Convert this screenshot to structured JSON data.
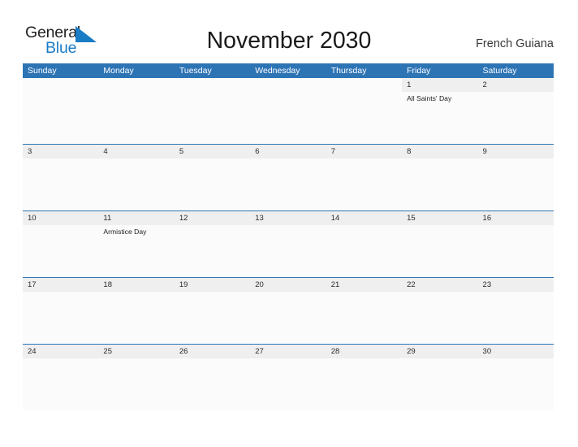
{
  "brand": {
    "name_part1": "General",
    "name_part2": "Blue",
    "flag_icon": "flag-triangle-icon",
    "color_dark": "#231f20",
    "color_blue": "#1a7cc4"
  },
  "header": {
    "title": "November 2030",
    "region": "French Guiana"
  },
  "calendar": {
    "header_background": "#2d74b5",
    "date_strip_background": "#efefef",
    "rule_color": "#2d74b5",
    "weekdays": [
      "Sunday",
      "Monday",
      "Tuesday",
      "Wednesday",
      "Thursday",
      "Friday",
      "Saturday"
    ],
    "weeks": [
      {
        "days": [
          {
            "date": "",
            "event": ""
          },
          {
            "date": "",
            "event": ""
          },
          {
            "date": "",
            "event": ""
          },
          {
            "date": "",
            "event": ""
          },
          {
            "date": "",
            "event": ""
          },
          {
            "date": "1",
            "event": "All Saints' Day"
          },
          {
            "date": "2",
            "event": ""
          }
        ]
      },
      {
        "days": [
          {
            "date": "3",
            "event": ""
          },
          {
            "date": "4",
            "event": ""
          },
          {
            "date": "5",
            "event": ""
          },
          {
            "date": "6",
            "event": ""
          },
          {
            "date": "7",
            "event": ""
          },
          {
            "date": "8",
            "event": ""
          },
          {
            "date": "9",
            "event": ""
          }
        ]
      },
      {
        "days": [
          {
            "date": "10",
            "event": ""
          },
          {
            "date": "11",
            "event": "Armistice Day"
          },
          {
            "date": "12",
            "event": ""
          },
          {
            "date": "13",
            "event": ""
          },
          {
            "date": "14",
            "event": ""
          },
          {
            "date": "15",
            "event": ""
          },
          {
            "date": "16",
            "event": ""
          }
        ]
      },
      {
        "days": [
          {
            "date": "17",
            "event": ""
          },
          {
            "date": "18",
            "event": ""
          },
          {
            "date": "19",
            "event": ""
          },
          {
            "date": "20",
            "event": ""
          },
          {
            "date": "21",
            "event": ""
          },
          {
            "date": "22",
            "event": ""
          },
          {
            "date": "23",
            "event": ""
          }
        ]
      },
      {
        "days": [
          {
            "date": "24",
            "event": ""
          },
          {
            "date": "25",
            "event": ""
          },
          {
            "date": "26",
            "event": ""
          },
          {
            "date": "27",
            "event": ""
          },
          {
            "date": "28",
            "event": ""
          },
          {
            "date": "29",
            "event": ""
          },
          {
            "date": "30",
            "event": ""
          }
        ]
      }
    ]
  }
}
